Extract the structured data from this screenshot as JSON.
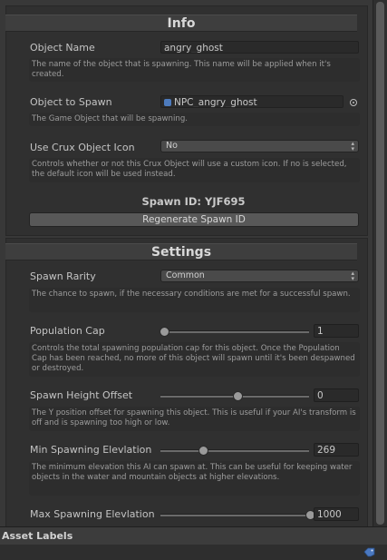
{
  "info": {
    "header": "Info",
    "object_name_label": "Object Name",
    "object_name_value": "angry_ghost",
    "object_name_help": "The name of the object that is spawning. This name will be applied when it's created.",
    "object_to_spawn_label": "Object to Spawn",
    "object_to_spawn_value": "NPC_angry_ghost",
    "object_to_spawn_help": "The Game Object that will be spawning.",
    "use_icon_label": "Use Crux Object Icon",
    "use_icon_value": "No",
    "use_icon_help": "Controls whether or not this Crux Object will use a custom icon. If no is selected, the default icon will be used instead.",
    "spawn_id": "Spawn ID: YJF695",
    "regenerate_button": "Regenerate Spawn ID"
  },
  "settings": {
    "header": "Settings",
    "spawn_rarity_label": "Spawn Rarity",
    "spawn_rarity_value": "Common",
    "spawn_rarity_help": "The chance to spawn, if the necessary conditions are met for a successful spawn.",
    "population_cap_label": "Population Cap",
    "population_cap_value": "1",
    "population_cap_fraction": 0.0,
    "population_cap_help": "Controls the total spawning population cap for this object. Once the Population Cap has been reached, no more of this object will spawn until it's been despawned or destroyed.",
    "height_offset_label": "Spawn Height Offset",
    "height_offset_value": "0",
    "height_offset_fraction": 0.5,
    "height_offset_help": "The Y position offset for spawning this object. This is useful if your AI's transform is off and is spawning too high or low.",
    "min_elevation_label": "Min Spawning Elevlation",
    "min_elevation_value": "269",
    "min_elevation_fraction": 0.27,
    "min_elevation_help": "The minimum elevation this AI can spawn at. This can be useful for keeping water objects in the water and mountain objects at higher elevations.",
    "max_elevation_label": "Max Spawning Elevlation",
    "max_elevation_value": "1000",
    "max_elevation_fraction": 1.0
  },
  "bottom": {
    "asset_labels": "Asset Labels"
  },
  "icons": {
    "object_icon": "cube-icon",
    "picker": "object-picker-icon",
    "dropdown": "dropdown-arrows-icon",
    "tag": "tag-icon"
  }
}
